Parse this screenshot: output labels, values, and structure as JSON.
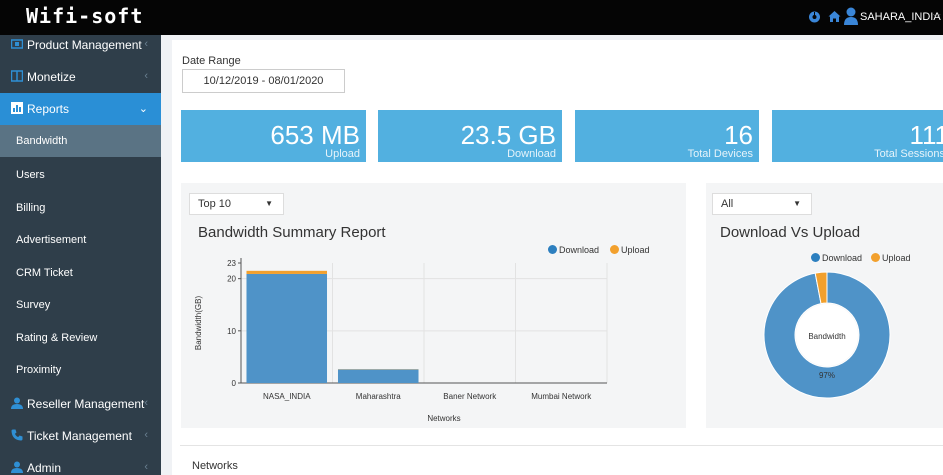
{
  "header": {
    "logo": "Wifi-soft",
    "logo_sub": "",
    "user_name": "SAHARA_INDIA",
    "icons": [
      "dashboard-icon",
      "home-icon",
      "user-icon",
      "chevron-down-icon"
    ]
  },
  "sidebar": {
    "items": [
      {
        "label": "Product Management",
        "icon": "box-icon"
      },
      {
        "label": "Monetize",
        "icon": "columns-icon"
      },
      {
        "label": "Reports",
        "icon": "bar-chart-icon"
      },
      {
        "label": "Reseller Management",
        "icon": "user-icon"
      },
      {
        "label": "Ticket Management",
        "icon": "phone-icon"
      },
      {
        "label": "Admin",
        "icon": "user-icon"
      }
    ],
    "submenu": [
      "Bandwidth",
      "Users",
      "Billing",
      "Advertisement",
      "CRM Ticket",
      "Survey",
      "Rating & Review",
      "Proximity"
    ]
  },
  "filters": {
    "date_range_label": "Date Range",
    "date_range_value": "10/12/2019 - 08/01/2020"
  },
  "stats": [
    {
      "value": "653 MB",
      "caption": "Upload"
    },
    {
      "value": "23.5 GB",
      "caption": "Download"
    },
    {
      "value": "16",
      "caption": "Total Devices"
    },
    {
      "value": "111",
      "caption": "Total Sessions"
    }
  ],
  "bandwidth_panel": {
    "select_value": "Top 10",
    "title": "Bandwidth Summary Report",
    "legend": [
      "Download",
      "Upload"
    ]
  },
  "dvu_panel": {
    "select_value": "All",
    "title": "Download Vs Upload",
    "legend": [
      "Download",
      "Upload"
    ],
    "center_label": "Bandwidth",
    "percent_label": "97%"
  },
  "colors": {
    "download": "#4f93c8",
    "upload": "#f2a02d",
    "accent": "#2a8fd6",
    "stat": "#52b0e0"
  },
  "chart_data": [
    {
      "type": "bar",
      "title": "Bandwidth Summary Report",
      "xlabel": "Networks",
      "ylabel": "Bandwidth(GB)",
      "categories": [
        "NASA_INDIA",
        "Maharashtra",
        "Baner Network",
        "Mumbai Network"
      ],
      "series": [
        {
          "name": "Download",
          "values": [
            20.9,
            2.6,
            0,
            0
          ]
        },
        {
          "name": "Upload",
          "values": [
            0.6,
            0.05,
            0,
            0
          ]
        }
      ],
      "yticks": [
        "0",
        "10",
        "20",
        "23"
      ],
      "ylim": [
        0,
        23
      ],
      "legend": "top-right"
    },
    {
      "type": "pie",
      "title": "Download Vs Upload",
      "labels": [
        "Download",
        "Upload"
      ],
      "values": [
        97,
        3
      ],
      "center_label": "Bandwidth",
      "legend": "top-right"
    }
  ],
  "networks_section": {
    "label": "Networks"
  }
}
